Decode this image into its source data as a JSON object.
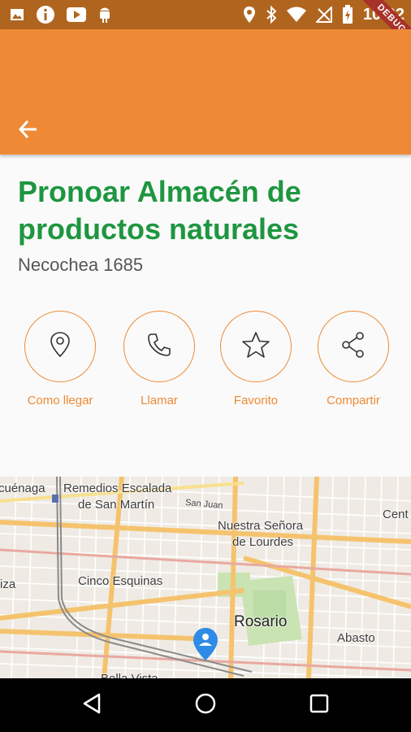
{
  "status_bar": {
    "time": "10:02",
    "debug_label": "DEBUG"
  },
  "place": {
    "name": "Pronoar Almacén de productos naturales",
    "address": "Necochea 1685"
  },
  "actions": [
    {
      "label": "Como llegar",
      "icon": "location-pin-icon"
    },
    {
      "label": "Llamar",
      "icon": "phone-icon"
    },
    {
      "label": "Favorito",
      "icon": "star-icon"
    },
    {
      "label": "Compartir",
      "icon": "share-icon"
    }
  ],
  "map": {
    "labels": {
      "l1": "cuénaga",
      "l2": "Remedios Escalada",
      "l3": "de San Martín",
      "l4": "San Juan",
      "l5": "Nuestra Señora",
      "l6": "de Lourdes",
      "l7": "Cent",
      "l8": "iza",
      "l9": "Cinco Esquinas",
      "l10": "Rosario",
      "l11": "Abasto",
      "l12": "Bella Vista"
    },
    "colors": {
      "road": "#f5c36e",
      "park": "#c9e3b3",
      "pin": "#2e8be6"
    }
  },
  "colors": {
    "accent": "#ee8a35",
    "title": "#1e9640",
    "status_bar": "#b0651f"
  }
}
